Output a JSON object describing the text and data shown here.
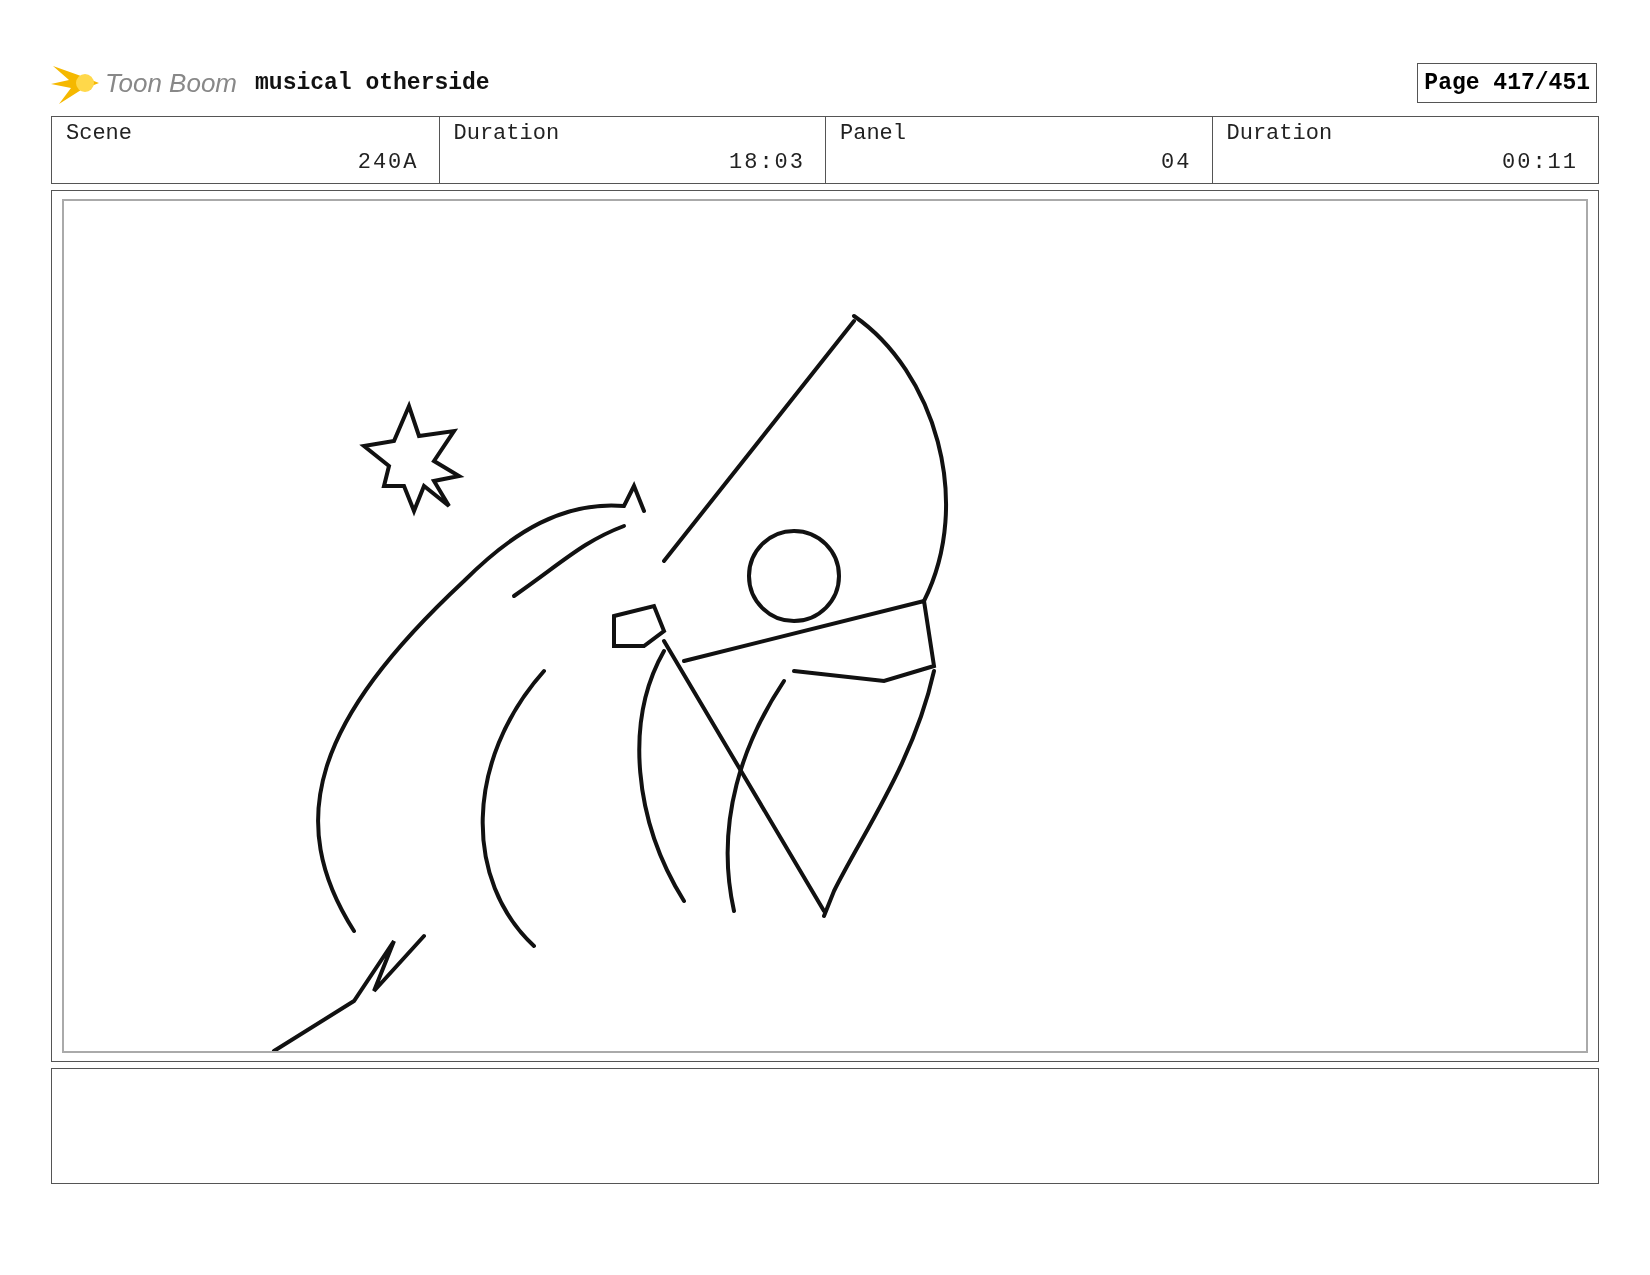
{
  "header": {
    "logo_text": "Toon Boom",
    "project_title": "musical otherside",
    "page": "Page 417/451"
  },
  "info": [
    {
      "label": "Scene",
      "value": "240A"
    },
    {
      "label": "Duration",
      "value": "18:03"
    },
    {
      "label": "Panel",
      "value": "04"
    },
    {
      "label": "Duration",
      "value": "00:11"
    }
  ]
}
